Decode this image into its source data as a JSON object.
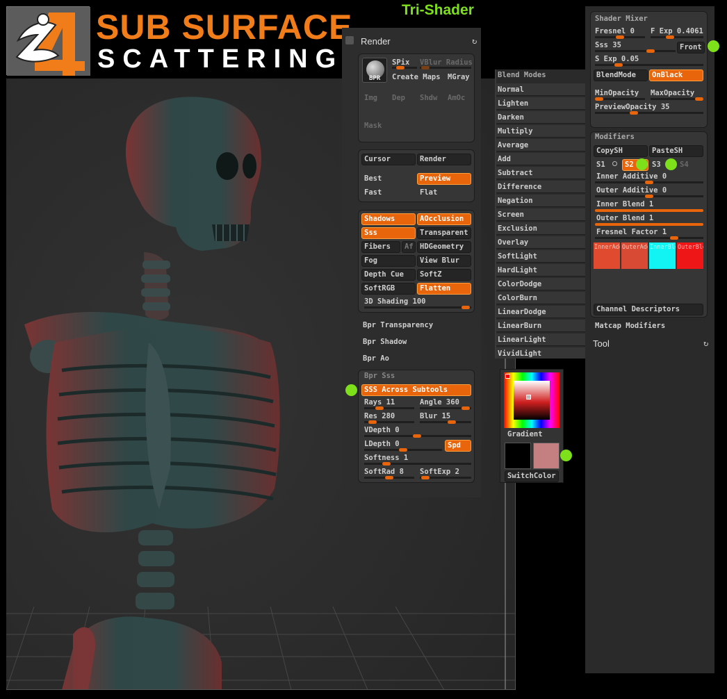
{
  "header": {
    "title_line1": "SUB SURFACE",
    "title_line2": "SCATTERING",
    "subtitle": "Tri-Shader",
    "logo_icon": "zbrush-4-logo-icon"
  },
  "render": {
    "title": "Render",
    "preview": {
      "bpr_label": "BPR",
      "spix": "SPix",
      "vblur": "VBlur Radius",
      "create_maps": "Create Maps",
      "mgray": "MGray",
      "img": "Img",
      "dep": "Dep",
      "shdw": "Shdw",
      "amoc": "AmOc",
      "mask": "Mask"
    },
    "modes": {
      "cursor": "Cursor",
      "render": "Render",
      "best": "Best",
      "preview": "Preview",
      "fast": "Fast",
      "flat": "Flat"
    },
    "properties": {
      "shadows": "Shadows",
      "aocclusion": "AOcclusion",
      "sss": "Sss",
      "transparent": "Transparent",
      "fibers": "Fibers",
      "af": "Af",
      "hdgeometry": "HDGeometry",
      "fog": "Fog",
      "view_blur": "View Blur",
      "depth_cue": "Depth Cue",
      "softz": "SoftZ",
      "softrgb": "SoftRGB",
      "flatten": "Flatten",
      "shading": "3D Shading 100",
      "shading_value": 1.0
    },
    "sections": {
      "bpr_transparency": "Bpr Transparency",
      "bpr_shadow": "Bpr Shadow",
      "bpr_ao": "Bpr Ao"
    },
    "bpr_sss": {
      "title": "Bpr Sss",
      "across": "SSS Across Subtools",
      "rays": "Rays 11",
      "rays_level": 0.3,
      "angle": "Angle 360",
      "angle_level": 0.95,
      "res": "Res 280",
      "res_level": 0.18,
      "blur": "Blur 15",
      "blur_level": 0.6,
      "vdepth": "VDepth 0",
      "vdepth_level": 0.5,
      "ldepth": "LDepth 0",
      "ldepth_level": 0.5,
      "spd": "Spd",
      "softness": "Softness 1",
      "softness_level": 0.2,
      "softrad": "SoftRad 8",
      "softrad_level": 0.5,
      "softexp": "SoftExp 2",
      "softexp_level": 0.1
    }
  },
  "blend": {
    "title": "Blend Modes",
    "selected": "Average",
    "items": [
      "Normal",
      "Lighten",
      "Darken",
      "Multiply",
      "Average",
      "Add",
      "Subtract",
      "Difference",
      "Negation",
      "Screen",
      "Exclusion",
      "Overlay",
      "SoftLight",
      "HardLight",
      "ColorDodge",
      "ColorBurn",
      "LinearDodge",
      "LinearBurn",
      "LinearLight",
      "VividLight"
    ]
  },
  "color": {
    "gradient": "Gradient",
    "switch": "SwitchColor",
    "main_color": "#000000",
    "secondary_color": "#c48080"
  },
  "mixer": {
    "title": "Shader Mixer",
    "fresnel": "Fresnel 0",
    "fresnel_level": 0.45,
    "fexp": "F Exp 0.4061",
    "fexp_level": 0.35,
    "sss": "Sss 35",
    "sss_level": 0.75,
    "front": "Front",
    "sexp": "S Exp 0.05",
    "sexp_level": 0.25,
    "blendmode": "BlendMode",
    "onblack": "OnBlack",
    "minop": "MinOpacity",
    "maxop": "MaxOpacity",
    "preview_op": "PreviewOpacity 35",
    "preview_op_level": 0.35
  },
  "modifiers": {
    "title": "Modifiers",
    "copysh": "CopySH",
    "pastesh": "PasteSH",
    "s1": "S1",
    "s2": "S2",
    "s3": "S3",
    "s4": "S4",
    "inner_add": "Inner Additive 0",
    "outer_add": "Outer Additive 0",
    "inner_blend": "Inner Blend 1",
    "outer_blend": "Outer Blend 1",
    "fresnel_factor": "Fresnel Factor 1",
    "fresnel_factor_level": 0.75,
    "swatches": [
      {
        "label": "InnerAdd",
        "color": "#e04a2e"
      },
      {
        "label": "OuterAdd",
        "color": "#d84a34"
      },
      {
        "label": "InnerBlend",
        "color": "#12f4f4"
      },
      {
        "label": "OuterBlend",
        "color": "#ee1616"
      }
    ],
    "channel": "Channel Descriptors"
  },
  "right": {
    "matcap": "Matcap Modifiers",
    "tool": "Tool"
  }
}
